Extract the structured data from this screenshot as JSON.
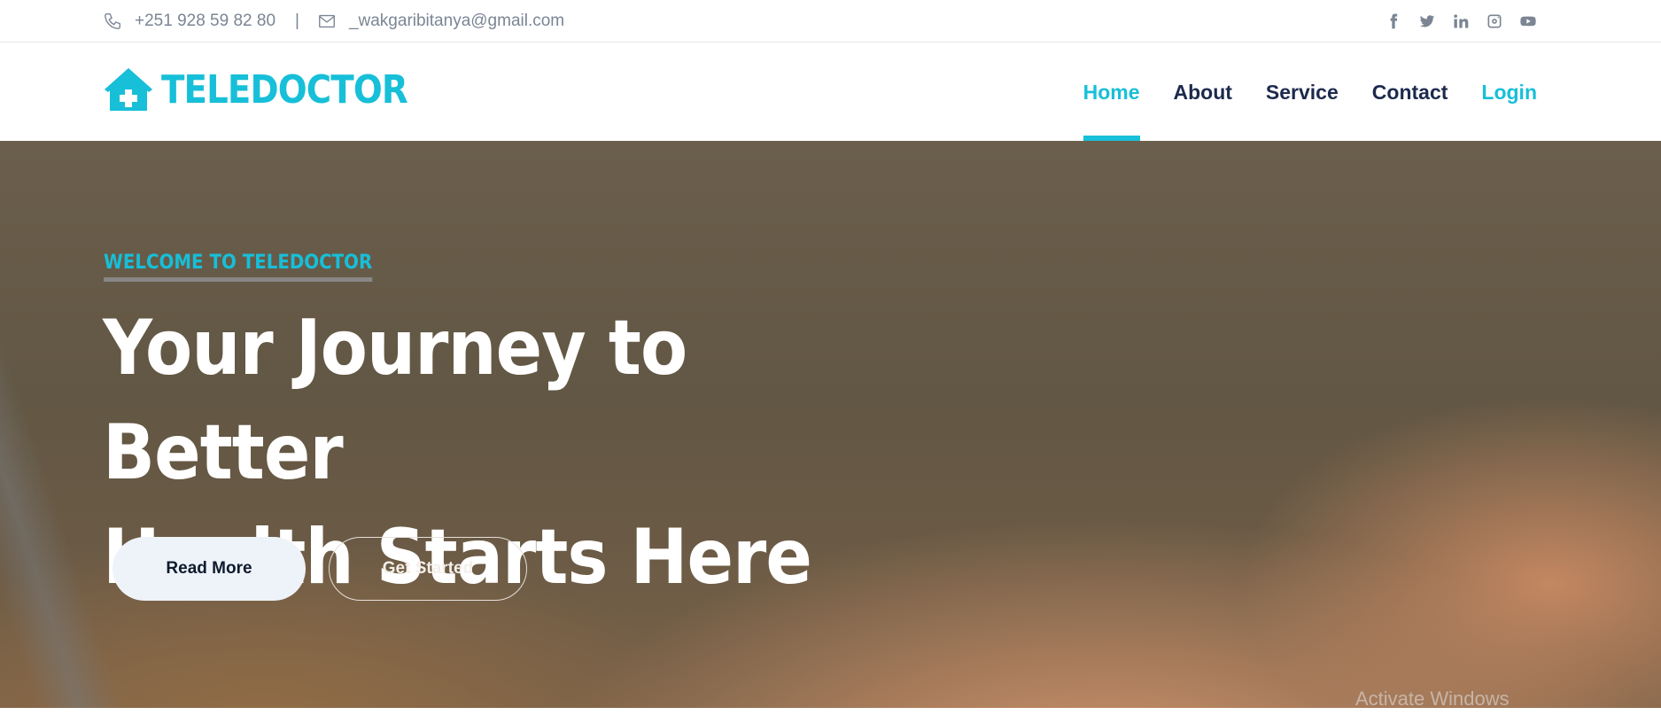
{
  "topbar": {
    "phone": "+251 928 59 82 80",
    "separator": "|",
    "email": "_wakgaribitanya@gmail.com",
    "social": [
      "facebook-icon",
      "twitter-icon",
      "linkedin-icon",
      "instagram-icon",
      "youtube-icon"
    ]
  },
  "brand": {
    "name": "TELEDOCTOR",
    "color": "#17bfd8"
  },
  "nav": {
    "items": [
      {
        "label": "Home",
        "active": true
      },
      {
        "label": "About"
      },
      {
        "label": "Service"
      },
      {
        "label": "Contact"
      }
    ],
    "login": "Login"
  },
  "hero": {
    "eyebrow": "WELCOME TO TELEDOCTOR",
    "headline_line1": "Your Journey to Better",
    "headline_line2": "Health Starts Here",
    "read_more": "Read More",
    "get_started": "Get Started"
  },
  "os": {
    "watermark": "Activate Windows"
  },
  "colors": {
    "accent": "#17bfd8",
    "nav_text": "#1d2a4d",
    "muted": "#7b8594"
  }
}
